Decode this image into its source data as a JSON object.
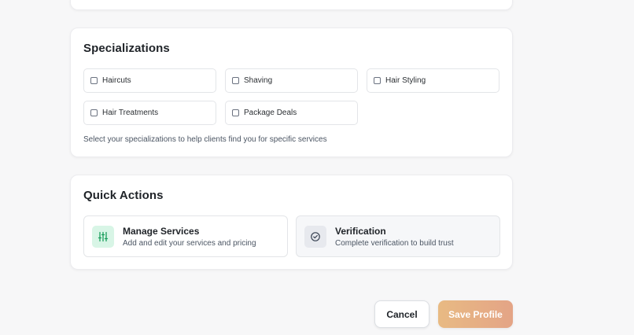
{
  "specializations": {
    "title": "Specializations",
    "options": [
      {
        "label": "Haircuts",
        "checked": false
      },
      {
        "label": "Shaving",
        "checked": false
      },
      {
        "label": "Hair Styling",
        "checked": false
      },
      {
        "label": "Hair Treatments",
        "checked": false
      },
      {
        "label": "Package Deals",
        "checked": false
      }
    ],
    "help_text": "Select your specializations to help clients find you for specific services"
  },
  "quick_actions": {
    "title": "Quick Actions",
    "items": [
      {
        "title": "Manage Services",
        "description": "Add and edit your services and pricing",
        "icon": "sliders-icon",
        "icon_color": "#1a9e5c"
      },
      {
        "title": "Verification",
        "description": "Complete verification to build trust",
        "icon": "check-circle-icon",
        "icon_color": "#374151"
      }
    ]
  },
  "actions": {
    "cancel_label": "Cancel",
    "save_label": "Save Profile"
  },
  "colors": {
    "save_gradient_start": "#e8ba83",
    "save_gradient_end": "#e4a486",
    "manage_icon_bg": "#d8f5e6"
  }
}
